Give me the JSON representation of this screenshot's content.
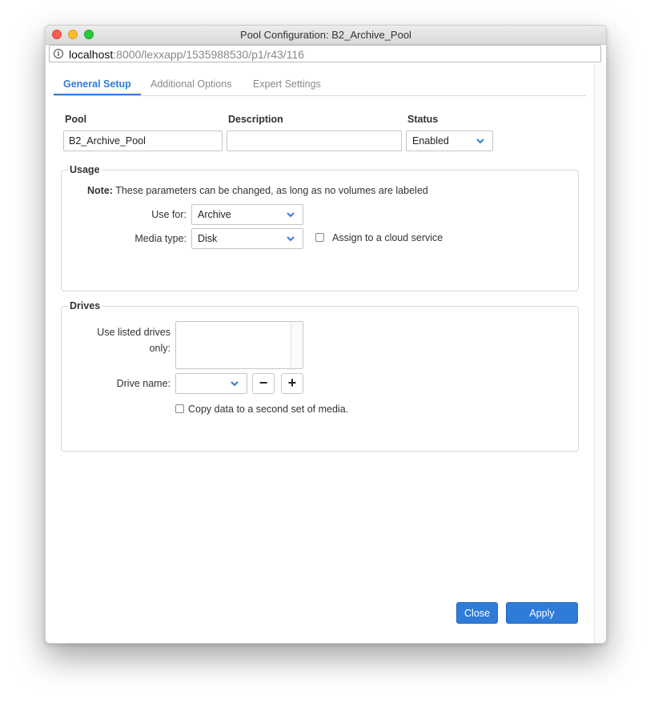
{
  "window": {
    "title": "Pool Configuration: B2_Archive_Pool",
    "url_host": "localhost",
    "url_rest": ":8000/lexxapp/1535988530/p1/r43/116"
  },
  "tabs": [
    {
      "label": "General Setup",
      "active": true
    },
    {
      "label": "Additional Options",
      "active": false
    },
    {
      "label": "Expert Settings",
      "active": false
    }
  ],
  "header_fields": {
    "pool_label": "Pool",
    "pool_value": "B2_Archive_Pool",
    "description_label": "Description",
    "description_value": "",
    "status_label": "Status",
    "status_value": "Enabled"
  },
  "usage": {
    "legend": "Usage",
    "note_bold": "Note:",
    "note_text": " These parameters can be changed, as long as no volumes are labeled",
    "use_for_label": "Use for:",
    "use_for_value": "Archive",
    "media_type_label": "Media type:",
    "media_type_value": "Disk",
    "cloud_label": "Assign to a cloud service",
    "cloud_checked": false
  },
  "drives": {
    "legend": "Drives",
    "use_listed_label": "Use listed drives only:",
    "drive_name_label": "Drive name:",
    "drive_name_value": "",
    "remove_symbol": "−",
    "add_symbol": "+",
    "copy_label": "Copy data to a second set of media.",
    "copy_checked": false
  },
  "buttons": {
    "close": "Close",
    "apply": "Apply"
  },
  "icons": {
    "info": "info-circle-icon",
    "dropdown": "chevron-down-icon"
  },
  "colors": {
    "accent": "#2f7bd8"
  }
}
